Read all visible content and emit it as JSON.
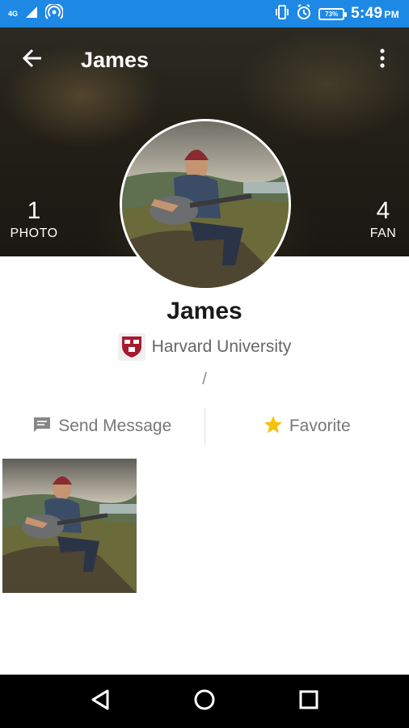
{
  "status_bar": {
    "network": "4G",
    "battery": "73%",
    "time": "5:49",
    "ampm": "PM"
  },
  "toolbar": {
    "title": "James"
  },
  "stats": {
    "photo_count": "1",
    "photo_label": "PHOTO",
    "fan_count": "4",
    "fan_label": "FAN"
  },
  "profile": {
    "name": "James",
    "school": "Harvard University",
    "separator": "/"
  },
  "actions": {
    "message_label": "Send Message",
    "favorite_label": "Favorite"
  },
  "colors": {
    "status_bar": "#1e88e5",
    "favorite_star": "#f4c20d",
    "school_red": "#a51c30"
  },
  "icons": [
    "back-arrow-icon",
    "more-vert-icon",
    "message-icon",
    "star-icon",
    "nav-back-icon",
    "nav-home-icon",
    "nav-recents-icon"
  ]
}
